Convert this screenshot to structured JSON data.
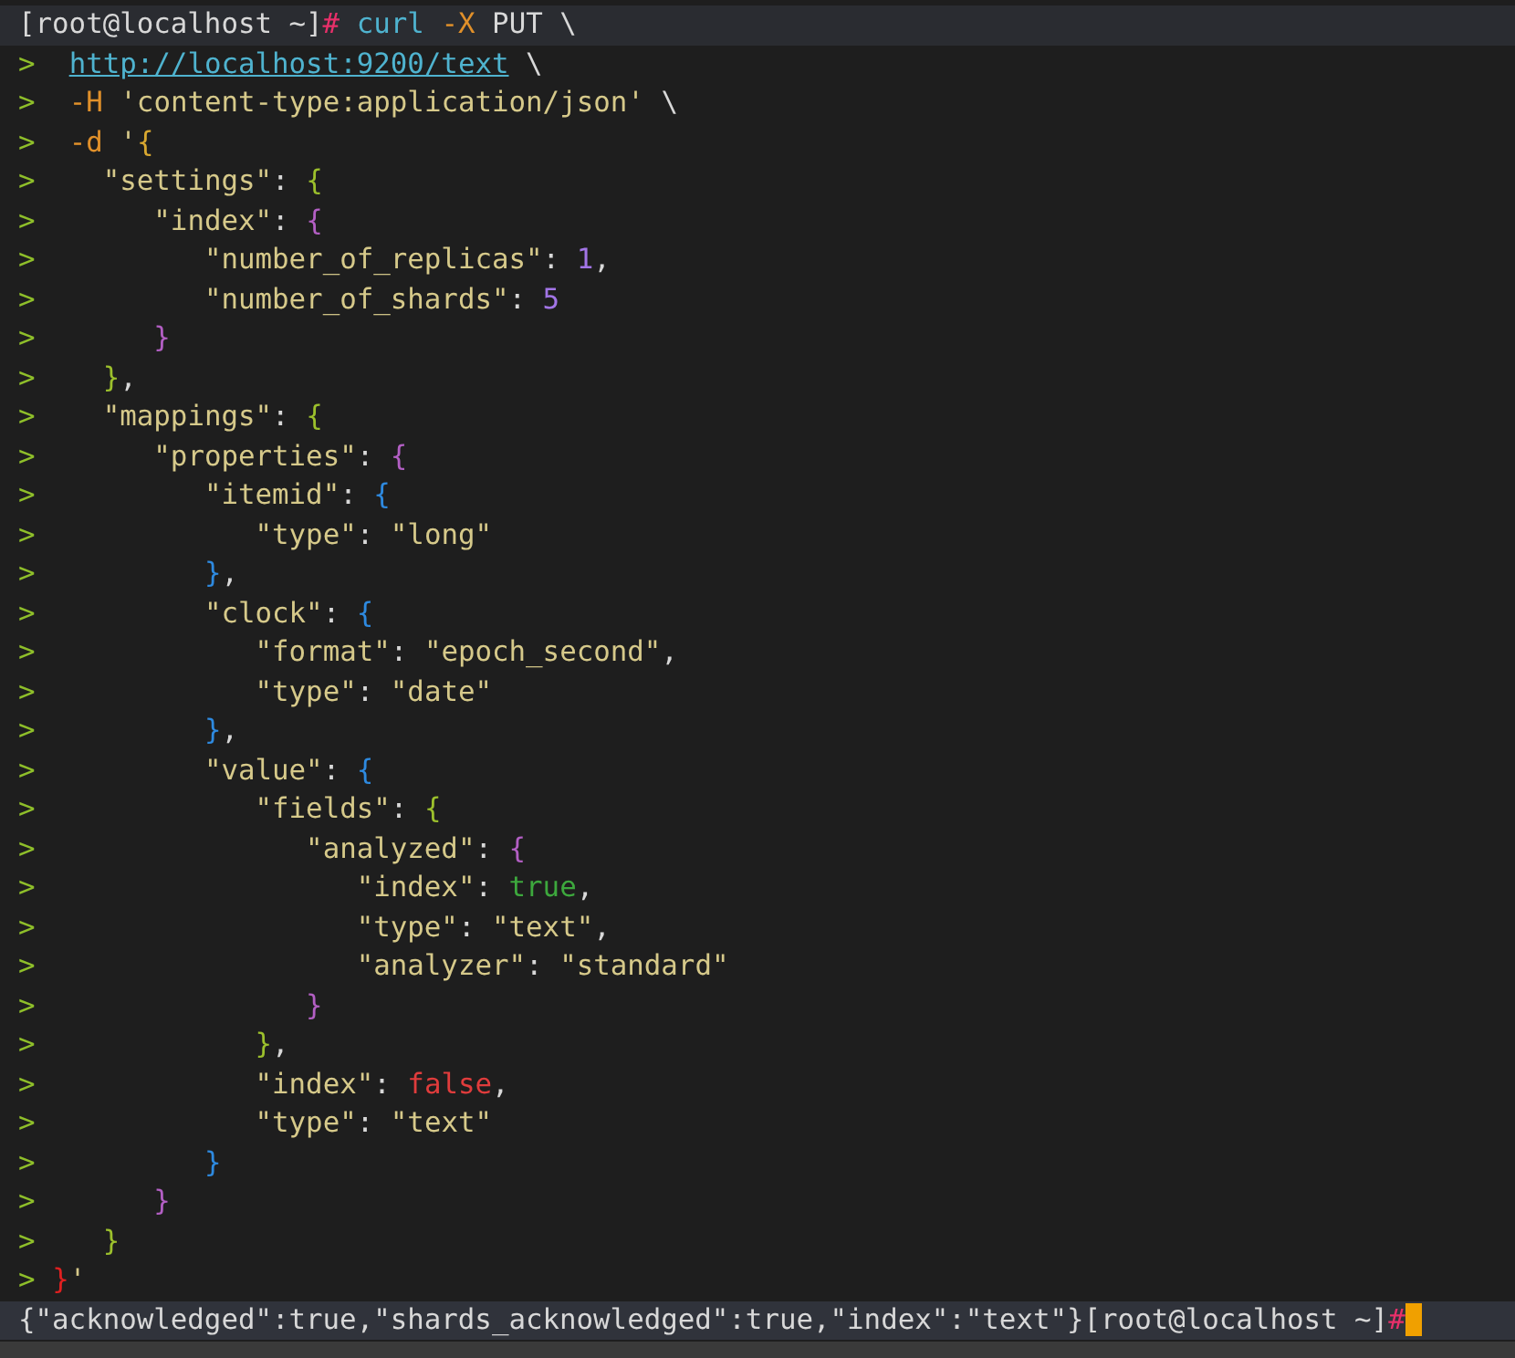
{
  "terminal": {
    "lines": [
      {
        "kind": "prompt",
        "tokens": [
          {
            "kind": "prompt",
            "text": "[root@localhost ~]"
          },
          {
            "kind": "hash",
            "text": "#"
          },
          {
            "kind": "command",
            "text": " curl"
          },
          {
            "kind": "flag",
            "text": " -X"
          },
          {
            "kind": "plain",
            "text": " PUT \\"
          }
        ]
      },
      {
        "kind": "continuation",
        "marker": ">",
        "tokens": [
          {
            "kind": "url",
            "text": "  http://localhost:9200/text"
          },
          {
            "kind": "plain",
            "text": " \\"
          }
        ]
      },
      {
        "kind": "continuation",
        "marker": ">",
        "tokens": [
          {
            "kind": "flag",
            "text": "  -H"
          },
          {
            "kind": "string",
            "text": " 'content-type:application/json'"
          },
          {
            "kind": "plain",
            "text": " \\"
          }
        ]
      },
      {
        "kind": "continuation",
        "marker": ">",
        "tokens": [
          {
            "kind": "flag",
            "text": "  -d"
          },
          {
            "kind": "string",
            "text": " '"
          },
          {
            "kind": "brace",
            "text": "{",
            "color": "#d9a830"
          }
        ]
      },
      {
        "kind": "continuation",
        "marker": ">",
        "tokens": [
          {
            "kind": "key",
            "text": "    \"settings\""
          },
          {
            "kind": "punct",
            "text": ": "
          },
          {
            "kind": "brace",
            "text": "{",
            "color": "#9cc02c"
          }
        ]
      },
      {
        "kind": "continuation",
        "marker": ">",
        "tokens": [
          {
            "kind": "key",
            "text": "       \"index\""
          },
          {
            "kind": "punct",
            "text": ": "
          },
          {
            "kind": "brace",
            "text": "{",
            "color": "#b35fc4"
          }
        ]
      },
      {
        "kind": "continuation",
        "marker": ">",
        "tokens": [
          {
            "kind": "key",
            "text": "          \"number_of_replicas\""
          },
          {
            "kind": "punct",
            "text": ": "
          },
          {
            "kind": "number",
            "text": "1"
          },
          {
            "kind": "punct",
            "text": ","
          }
        ]
      },
      {
        "kind": "continuation",
        "marker": ">",
        "tokens": [
          {
            "kind": "key",
            "text": "          \"number_of_shards\""
          },
          {
            "kind": "punct",
            "text": ": "
          },
          {
            "kind": "number",
            "text": "5"
          }
        ]
      },
      {
        "kind": "continuation",
        "marker": ">",
        "tokens": [
          {
            "kind": "brace",
            "text": "       }",
            "color": "#b35fc4"
          }
        ]
      },
      {
        "kind": "continuation",
        "marker": ">",
        "tokens": [
          {
            "kind": "brace",
            "text": "    }",
            "color": "#9cc02c"
          },
          {
            "kind": "punct",
            "text": ","
          }
        ]
      },
      {
        "kind": "continuation",
        "marker": ">",
        "tokens": [
          {
            "kind": "key",
            "text": "    \"mappings\""
          },
          {
            "kind": "punct",
            "text": ": "
          },
          {
            "kind": "brace",
            "text": "{",
            "color": "#9cc02c"
          }
        ]
      },
      {
        "kind": "continuation",
        "marker": ">",
        "tokens": [
          {
            "kind": "key",
            "text": "       \"properties\""
          },
          {
            "kind": "punct",
            "text": ": "
          },
          {
            "kind": "brace",
            "text": "{",
            "color": "#b35fc4"
          }
        ]
      },
      {
        "kind": "continuation",
        "marker": ">",
        "tokens": [
          {
            "kind": "key",
            "text": "          \"itemid\""
          },
          {
            "kind": "punct",
            "text": ": "
          },
          {
            "kind": "brace",
            "text": "{",
            "color": "#2e8ae0"
          }
        ]
      },
      {
        "kind": "continuation",
        "marker": ">",
        "tokens": [
          {
            "kind": "key",
            "text": "             \"type\""
          },
          {
            "kind": "punct",
            "text": ": "
          },
          {
            "kind": "string",
            "text": "\"long\""
          }
        ]
      },
      {
        "kind": "continuation",
        "marker": ">",
        "tokens": [
          {
            "kind": "brace",
            "text": "          }",
            "color": "#2e8ae0"
          },
          {
            "kind": "punct",
            "text": ","
          }
        ]
      },
      {
        "kind": "continuation",
        "marker": ">",
        "tokens": [
          {
            "kind": "key",
            "text": "          \"clock\""
          },
          {
            "kind": "punct",
            "text": ": "
          },
          {
            "kind": "brace",
            "text": "{",
            "color": "#2e8ae0"
          }
        ]
      },
      {
        "kind": "continuation",
        "marker": ">",
        "tokens": [
          {
            "kind": "key",
            "text": "             \"format\""
          },
          {
            "kind": "punct",
            "text": ": "
          },
          {
            "kind": "string",
            "text": "\"epoch_second\""
          },
          {
            "kind": "punct",
            "text": ","
          }
        ]
      },
      {
        "kind": "continuation",
        "marker": ">",
        "tokens": [
          {
            "kind": "key",
            "text": "             \"type\""
          },
          {
            "kind": "punct",
            "text": ": "
          },
          {
            "kind": "string",
            "text": "\"date\""
          }
        ]
      },
      {
        "kind": "continuation",
        "marker": ">",
        "tokens": [
          {
            "kind": "brace",
            "text": "          }",
            "color": "#2e8ae0"
          },
          {
            "kind": "punct",
            "text": ","
          }
        ]
      },
      {
        "kind": "continuation",
        "marker": ">",
        "tokens": [
          {
            "kind": "key",
            "text": "          \"value\""
          },
          {
            "kind": "punct",
            "text": ": "
          },
          {
            "kind": "brace",
            "text": "{",
            "color": "#2e8ae0"
          }
        ]
      },
      {
        "kind": "continuation",
        "marker": ">",
        "tokens": [
          {
            "kind": "key",
            "text": "             \"fields\""
          },
          {
            "kind": "punct",
            "text": ": "
          },
          {
            "kind": "brace",
            "text": "{",
            "color": "#9cc02c"
          }
        ]
      },
      {
        "kind": "continuation",
        "marker": ">",
        "tokens": [
          {
            "kind": "key",
            "text": "                \"analyzed\""
          },
          {
            "kind": "punct",
            "text": ": "
          },
          {
            "kind": "brace",
            "text": "{",
            "color": "#b35fc4"
          }
        ]
      },
      {
        "kind": "continuation",
        "marker": ">",
        "tokens": [
          {
            "kind": "key",
            "text": "                   \"index\""
          },
          {
            "kind": "punct",
            "text": ": "
          },
          {
            "kind": "keyword",
            "text": "true",
            "color": "#3da83d"
          },
          {
            "kind": "punct",
            "text": ","
          }
        ]
      },
      {
        "kind": "continuation",
        "marker": ">",
        "tokens": [
          {
            "kind": "key",
            "text": "                   \"type\""
          },
          {
            "kind": "punct",
            "text": ": "
          },
          {
            "kind": "string",
            "text": "\"text\""
          },
          {
            "kind": "punct",
            "text": ","
          }
        ]
      },
      {
        "kind": "continuation",
        "marker": ">",
        "tokens": [
          {
            "kind": "key",
            "text": "                   \"analyzer\""
          },
          {
            "kind": "punct",
            "text": ": "
          },
          {
            "kind": "string",
            "text": "\"standard\""
          }
        ]
      },
      {
        "kind": "continuation",
        "marker": ">",
        "tokens": [
          {
            "kind": "brace",
            "text": "                }",
            "color": "#b35fc4"
          }
        ]
      },
      {
        "kind": "continuation",
        "marker": ">",
        "tokens": [
          {
            "kind": "brace",
            "text": "             }",
            "color": "#9cc02c"
          },
          {
            "kind": "punct",
            "text": ","
          }
        ]
      },
      {
        "kind": "continuation",
        "marker": ">",
        "tokens": [
          {
            "kind": "key",
            "text": "             \"index\""
          },
          {
            "kind": "punct",
            "text": ": "
          },
          {
            "kind": "keyword",
            "text": "false",
            "color": "#e03c3c"
          },
          {
            "kind": "punct",
            "text": ","
          }
        ]
      },
      {
        "kind": "continuation",
        "marker": ">",
        "tokens": [
          {
            "kind": "key",
            "text": "             \"type\""
          },
          {
            "kind": "punct",
            "text": ": "
          },
          {
            "kind": "string",
            "text": "\"text\""
          }
        ]
      },
      {
        "kind": "continuation",
        "marker": ">",
        "tokens": [
          {
            "kind": "brace",
            "text": "          }",
            "color": "#2e8ae0"
          }
        ]
      },
      {
        "kind": "continuation",
        "marker": ">",
        "tokens": [
          {
            "kind": "brace",
            "text": "       }",
            "color": "#b35fc4"
          }
        ]
      },
      {
        "kind": "continuation",
        "marker": ">",
        "tokens": [
          {
            "kind": "brace",
            "text": "    }",
            "color": "#9cc02c"
          }
        ]
      },
      {
        "kind": "continuation",
        "marker": ">",
        "tokens": [
          {
            "kind": "brace",
            "text": " }",
            "color": "#e02020"
          },
          {
            "kind": "string",
            "text": "'"
          }
        ]
      },
      {
        "kind": "output",
        "cursor": true,
        "tokens": [
          {
            "kind": "plain",
            "text": "{\"acknowledged\":true,\"shards_acknowledged\":true,\"index\":\"text\"}"
          },
          {
            "kind": "prompt",
            "text": "[root@localhost ~]"
          },
          {
            "kind": "hash",
            "text": "#"
          }
        ]
      }
    ]
  }
}
